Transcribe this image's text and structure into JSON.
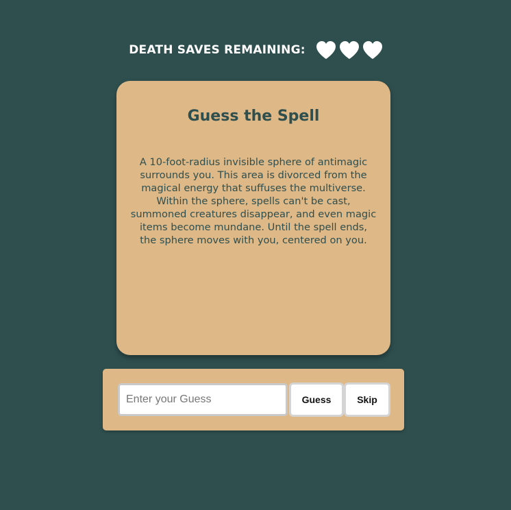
{
  "header": {
    "label": "DEATH SAVES REMAINING:",
    "hearts_remaining": 3,
    "heart_color": "#ffffff"
  },
  "card": {
    "title": "Guess the Spell",
    "description": "A 10-foot-radius invisible sphere of antimagic surrounds you. This area is divorced from the magical energy that suffuses the multiverse. Within the sphere, spells can't be cast, summoned creatures disappear, and even magic items become mundane. Until the spell ends, the sphere moves with you, centered on you."
  },
  "guess_form": {
    "placeholder": "Enter your Guess",
    "value": "",
    "guess_label": "Guess",
    "skip_label": "Skip"
  },
  "colors": {
    "background": "#2f4f4f",
    "card": "#deb887",
    "card_text": "#2f4f4f"
  }
}
